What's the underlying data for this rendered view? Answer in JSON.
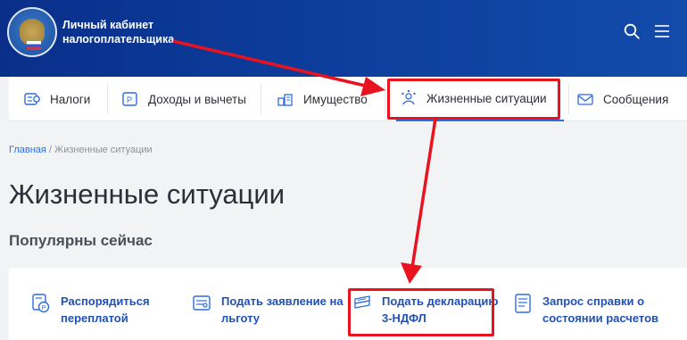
{
  "header": {
    "brand_line1": "Личный кабинет",
    "brand_line2": "налогоплательщика",
    "icons": [
      "emblem-icon",
      "search-icon",
      "menu-icon"
    ]
  },
  "nav": {
    "items": [
      {
        "label": "Налоги",
        "icon": "taxes-icon"
      },
      {
        "label": "Доходы и вычеты",
        "icon": "income-icon"
      },
      {
        "label": "Имущество",
        "icon": "property-icon"
      },
      {
        "label": "Жизненные ситуации",
        "icon": "life-situations-icon",
        "active": true
      },
      {
        "label": "Сообщения",
        "icon": "messages-icon"
      }
    ]
  },
  "breadcrumb": {
    "home": "Главная",
    "separator": " / ",
    "current": "Жизненные ситуации"
  },
  "page": {
    "title": "Жизненные ситуации",
    "section_title": "Популярны сейчас"
  },
  "cards": [
    {
      "line1": "Распорядиться",
      "line2": "переплатой",
      "icon": "ruble-coin-icon"
    },
    {
      "line1": "Подать заявление на",
      "line2": "льготу",
      "icon": "application-icon"
    },
    {
      "line1": "Подать декларацию",
      "line2": "3-НДФЛ",
      "icon": "declaration-icon"
    },
    {
      "line1": "Запрос справки о",
      "line2": "состоянии расчетов",
      "icon": "certificate-icon"
    }
  ],
  "colors": {
    "header_bg": "#0c3d9c",
    "link": "#2050b8",
    "highlight": "#e8131f"
  }
}
